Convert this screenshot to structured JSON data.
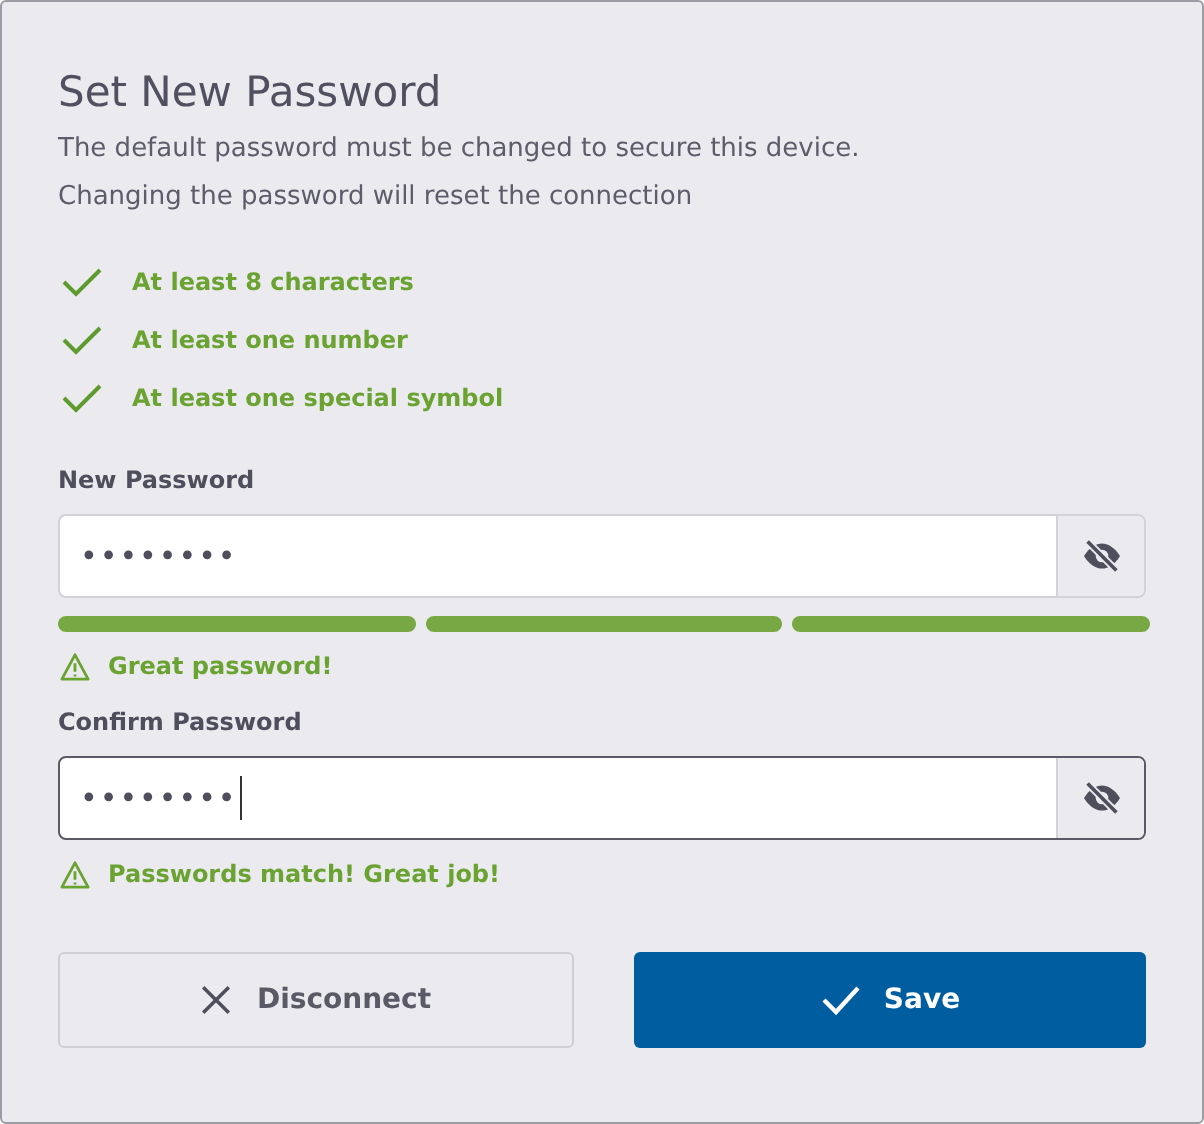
{
  "dialog": {
    "title": "Set New Password",
    "description": [
      "The default password must be changed to secure this device.",
      "Changing the password will reset the connection"
    ]
  },
  "requirements": [
    {
      "label": "At least 8 characters",
      "met": true
    },
    {
      "label": "At least one number",
      "met": true
    },
    {
      "label": "At least one special symbol",
      "met": true
    }
  ],
  "fields": [
    {
      "label": "New Password",
      "value": "••••••••",
      "focused": false,
      "strength_segments": [
        {
          "filled": true
        },
        {
          "filled": true
        },
        {
          "filled": true
        }
      ],
      "message": "Great password!"
    },
    {
      "label": "Confirm Password",
      "value": "••••••••",
      "focused": true,
      "message": "Passwords match! Great job!"
    }
  ],
  "buttons": [
    {
      "label": "Disconnect",
      "kind": "secondary"
    },
    {
      "label": "Save",
      "kind": "primary"
    }
  ]
}
